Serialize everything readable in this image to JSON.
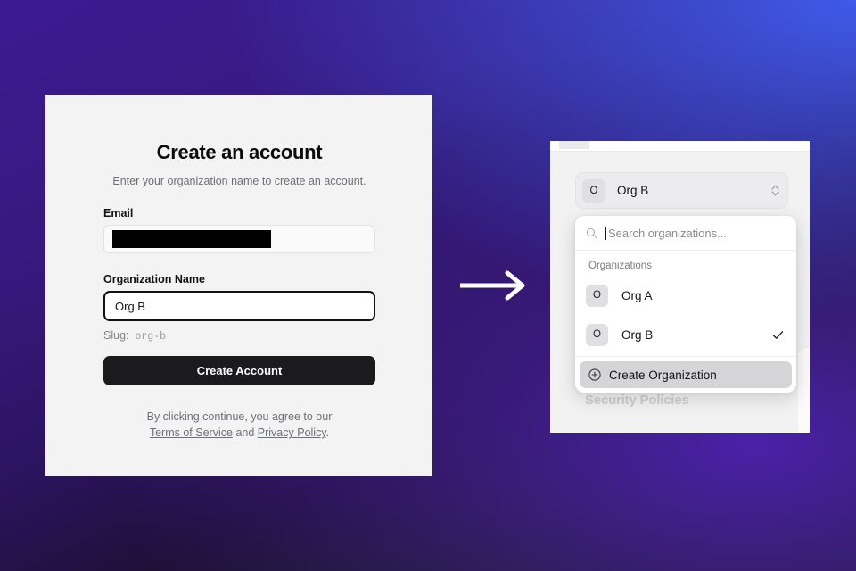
{
  "background": {
    "gradient_from": "#3c1b92",
    "gradient_to": "#3f5ae8",
    "gradient_dark": "#1a1a1c"
  },
  "left_card": {
    "title": "Create an account",
    "subtitle": "Enter your organization name to create an account.",
    "email_field": {
      "label": "Email",
      "value": "",
      "placeholder": "",
      "redacted": true
    },
    "org_name_field": {
      "label": "Organization Name",
      "value": "Org B",
      "placeholder": "Organization name",
      "focused": true
    },
    "slug": {
      "label": "Slug:",
      "value": "org-b"
    },
    "submit_label": "Create Account",
    "legal": {
      "prefix": "By clicking continue, you agree to our",
      "terms_label": "Terms of Service",
      "conjunction": "and",
      "privacy_label": "Privacy Policy",
      "suffix": "."
    }
  },
  "arrow": {
    "icon": "arrow-right-icon",
    "color": "#ffffff"
  },
  "right_panel": {
    "background_heading": "Security Policies",
    "org_selector": {
      "avatar_initial": "O",
      "name": "Org B",
      "icon": "chevron-up-down-icon"
    },
    "dropdown": {
      "search": {
        "icon": "search-icon",
        "placeholder": "Search organizations...",
        "value": "",
        "cursor_visible": true
      },
      "group_label": "Organizations",
      "items": [
        {
          "avatar_initial": "O",
          "name": "Org A",
          "selected": false
        },
        {
          "avatar_initial": "O",
          "name": "Org B",
          "selected": true
        }
      ],
      "check_icon": "check-icon",
      "create": {
        "icon": "plus-circle-icon",
        "label": "Create Organization",
        "highlighted": true
      }
    }
  }
}
